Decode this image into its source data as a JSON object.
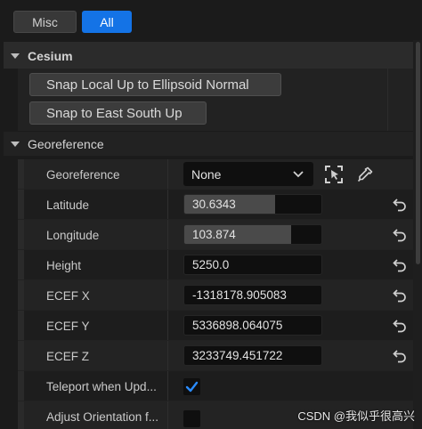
{
  "tabs": {
    "misc": "Misc",
    "all": "All"
  },
  "sections": {
    "cesium": {
      "title": "Cesium",
      "buttons": [
        "Snap Local Up to Ellipsoid Normal",
        "Snap to East South Up"
      ]
    },
    "georeference": {
      "title": "Georeference"
    }
  },
  "properties": {
    "georeference": {
      "label": "Georeference",
      "value": "None",
      "icons": [
        "crosshair-select-icon",
        "eyedropper-icon"
      ]
    },
    "latitude": {
      "label": "Latitude",
      "value": "30.6343",
      "fill_fraction": 0.66
    },
    "longitude": {
      "label": "Longitude",
      "value": "103.874",
      "fill_fraction": 0.78
    },
    "height": {
      "label": "Height",
      "value": "5250.0"
    },
    "ecef_x": {
      "label": "ECEF X",
      "value": "-1318178.905083"
    },
    "ecef_y": {
      "label": "ECEF Y",
      "value": "5336898.064075"
    },
    "ecef_z": {
      "label": "ECEF Z",
      "value": "3233749.451722"
    },
    "teleport": {
      "label": "Teleport when Upd...",
      "checked": true
    },
    "adjust": {
      "label": "Adjust Orientation f..."
    }
  },
  "watermark": "CSDN @我似乎很高兴",
  "colors": {
    "accent": "#1473e6",
    "background": "#1b1b1b",
    "field": "#0f0f0f"
  }
}
